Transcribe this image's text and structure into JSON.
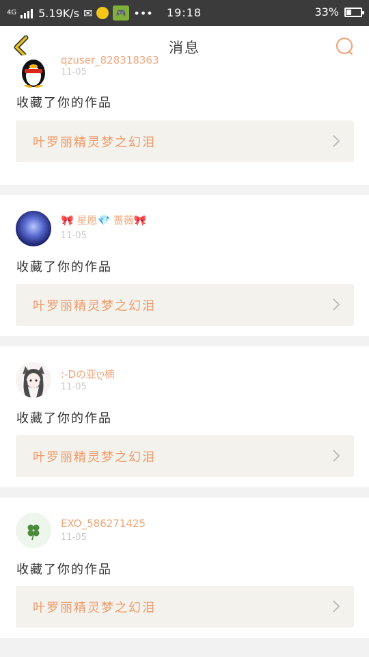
{
  "status_bar": {
    "network": "4G",
    "speed": "5.19K/s",
    "more": "•••",
    "time": "19:18",
    "battery_pct": "33%",
    "battery_level": 0.33
  },
  "header": {
    "title": "消息"
  },
  "notifications": [
    {
      "username": "qzuser_828318363",
      "date": "11-05",
      "action": "收藏了你的作品",
      "work_title": "叶罗丽精灵梦之幻泪"
    },
    {
      "username": "🎀 星愿💎 蔷薇🎀",
      "date": "11-05",
      "action": "收藏了你的作品",
      "work_title": "叶罗丽精灵梦之幻泪"
    },
    {
      "username": ":-Dの亚ღ楠",
      "date": "11-05",
      "action": "收藏了你的作品",
      "work_title": "叶罗丽精灵梦之幻泪"
    },
    {
      "username": "EXO_586271425",
      "date": "11-05",
      "action": "收藏了你的作品",
      "work_title": "叶罗丽精灵梦之幻泪"
    }
  ]
}
